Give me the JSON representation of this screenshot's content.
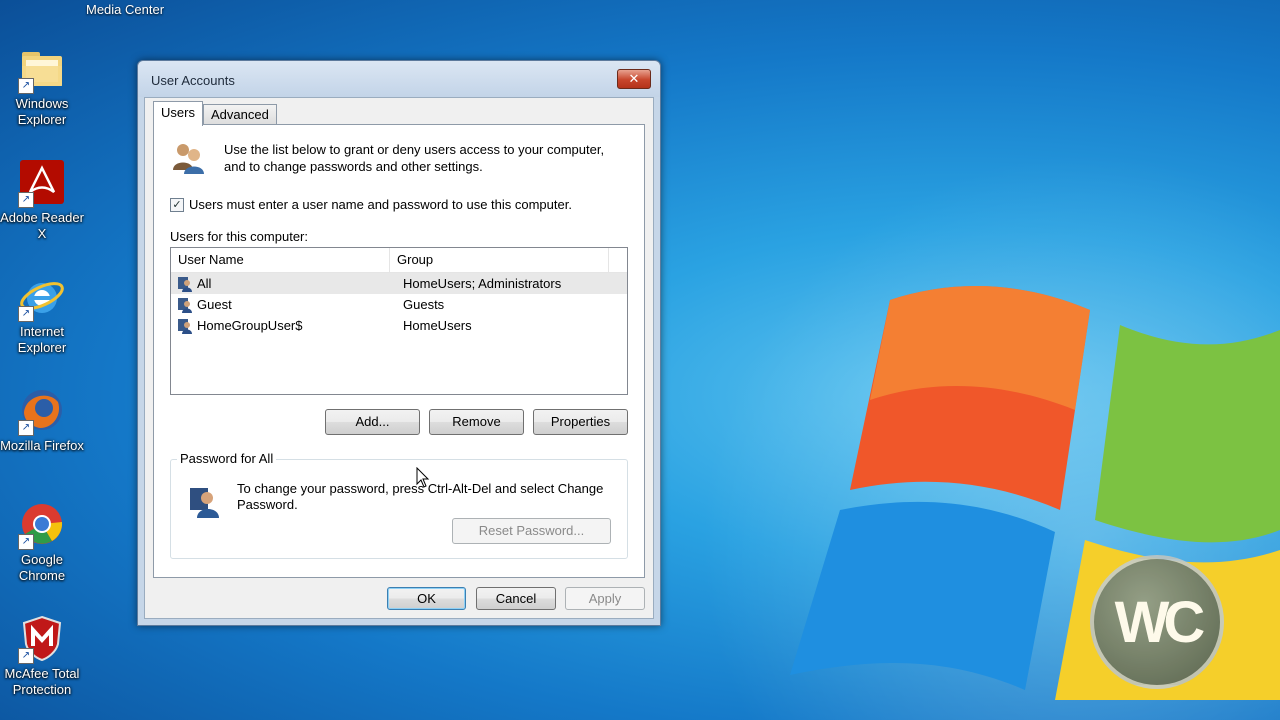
{
  "desktop": {
    "top_label": "Media Center",
    "icons": [
      {
        "name": "windows-explorer",
        "label": "Windows Explorer"
      },
      {
        "name": "adobe-reader",
        "label": "Adobe Reader X"
      },
      {
        "name": "internet-explorer",
        "label": "Internet Explorer"
      },
      {
        "name": "mozilla-firefox",
        "label": "Mozilla Firefox"
      },
      {
        "name": "google-chrome",
        "label": "Google Chrome"
      },
      {
        "name": "mcafee",
        "label": "McAfee Total Protection"
      }
    ],
    "watermark": "WC"
  },
  "dialog": {
    "title": "User Accounts",
    "close_glyph": "✕",
    "tabs": [
      {
        "label": "Users",
        "active": true
      },
      {
        "label": "Advanced",
        "active": false
      }
    ],
    "intro_text": "Use the list below to grant or deny users access to your computer, and to change passwords and other settings.",
    "require_login": {
      "checked": true,
      "label": "Users must enter a user name and password to use this computer."
    },
    "users_label": "Users for this computer:",
    "columns": [
      "User Name",
      "Group"
    ],
    "users": [
      {
        "name": "All",
        "group": "HomeUsers; Administrators",
        "selected": true
      },
      {
        "name": "Guest",
        "group": "Guests",
        "selected": false
      },
      {
        "name": "HomeGroupUser$",
        "group": "HomeUsers",
        "selected": false
      }
    ],
    "buttons": {
      "add": "Add...",
      "remove": "Remove",
      "properties": "Properties"
    },
    "password_group": {
      "legend": "Password for All",
      "text": "To change your password, press Ctrl-Alt-Del and select Change Password.",
      "reset_button": "Reset Password..."
    },
    "footer": {
      "ok": "OK",
      "cancel": "Cancel",
      "apply": "Apply"
    }
  }
}
